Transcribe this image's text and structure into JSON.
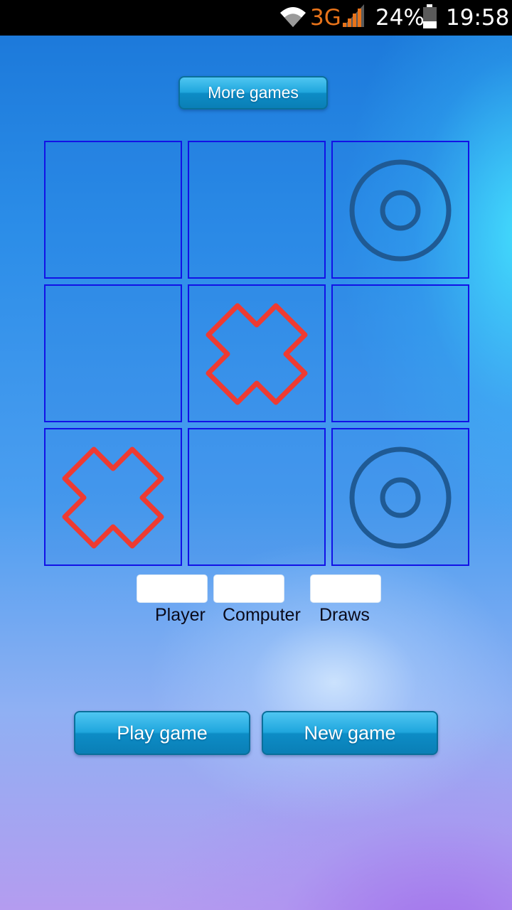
{
  "status_bar": {
    "network": "3G",
    "battery": "24%",
    "time": "19:58",
    "icons": [
      "wifi-icon",
      "signal-icon",
      "battery-icon"
    ]
  },
  "buttons": {
    "more_games": "More games",
    "play_game": "Play game",
    "new_game": "New game"
  },
  "board": {
    "cells": [
      [
        "",
        "",
        "O"
      ],
      [
        "",
        "X",
        ""
      ],
      [
        "X",
        "",
        "O"
      ]
    ]
  },
  "scores": {
    "player_label": "Player",
    "computer_label": "Computer",
    "draws_label": "Draws",
    "player_value": "",
    "computer_value": "",
    "draws_value": ""
  },
  "colors": {
    "x_mark": "#ee3b32",
    "o_mark": "#1f5a94",
    "cell_border": "#1212e6",
    "button": "#1fa6dd"
  }
}
